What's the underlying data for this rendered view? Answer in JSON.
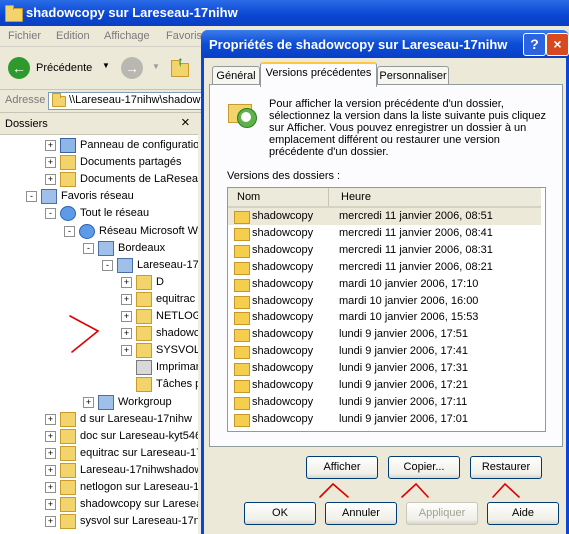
{
  "explorer": {
    "title": "shadowcopy sur Lareseau-17nihw",
    "menu": [
      "Fichier",
      "Edition",
      "Affichage",
      "Favoris"
    ],
    "back_label": "Précédente",
    "address_label": "Adresse",
    "address_value": "\\\\Lareseau-17nihw\\shadow",
    "folders_title": "Dossiers",
    "close_glyph": "×",
    "tree": [
      {
        "label": "Panneau de configuration",
        "indent": 1,
        "pm": "+",
        "icon": "control-panel-icon"
      },
      {
        "label": "Documents partagés",
        "indent": 1,
        "pm": "+",
        "icon": "folder-icon"
      },
      {
        "label": "Documents de LaReseau",
        "indent": 1,
        "pm": "+",
        "icon": "folder-icon"
      },
      {
        "label": "Favoris réseau",
        "indent": 0,
        "pm": "-",
        "icon": "network-places-icon"
      },
      {
        "label": "Tout le réseau",
        "indent": 1,
        "pm": "-",
        "icon": "globe-icon"
      },
      {
        "label": "Réseau Microsoft Win",
        "indent": 2,
        "pm": "-",
        "icon": "network-icon"
      },
      {
        "label": "Bordeaux",
        "indent": 3,
        "pm": "-",
        "icon": "workgroup-icon"
      },
      {
        "label": "Lareseau-17n",
        "indent": 4,
        "pm": "-",
        "icon": "computer-icon"
      },
      {
        "label": "D",
        "indent": 5,
        "pm": "+",
        "icon": "share-icon"
      },
      {
        "label": "equitrac",
        "indent": 5,
        "pm": "+",
        "icon": "share-icon"
      },
      {
        "label": "NETLOGC",
        "indent": 5,
        "pm": "+",
        "icon": "share-icon"
      },
      {
        "label": "shadowco",
        "indent": 5,
        "pm": "+",
        "icon": "share-icon"
      },
      {
        "label": "SYSVOL",
        "indent": 5,
        "pm": "+",
        "icon": "share-icon"
      },
      {
        "label": "Imprimant",
        "indent": 5,
        "pm": "",
        "icon": "printer-icon"
      },
      {
        "label": "Tâches pl",
        "indent": 5,
        "pm": "",
        "icon": "scheduled-tasks-icon"
      },
      {
        "label": "Workgroup",
        "indent": 3,
        "pm": "+",
        "icon": "workgroup-icon"
      },
      {
        "label": "d sur Lareseau-17nihw",
        "indent": 1,
        "pm": "+",
        "icon": "share-icon"
      },
      {
        "label": "doc sur Lareseau-kyt546",
        "indent": 1,
        "pm": "+",
        "icon": "share-icon"
      },
      {
        "label": "equitrac sur Lareseau-17n",
        "indent": 1,
        "pm": "+",
        "icon": "share-icon"
      },
      {
        "label": "Lareseau-17nihwshadow",
        "indent": 1,
        "pm": "+",
        "icon": "share-icon"
      },
      {
        "label": "netlogon sur Lareseau-17",
        "indent": 1,
        "pm": "+",
        "icon": "share-icon"
      },
      {
        "label": "shadowcopy sur Lareseau",
        "indent": 1,
        "pm": "+",
        "icon": "share-icon"
      },
      {
        "label": "sysvol sur Lareseau-17nil",
        "indent": 1,
        "pm": "+",
        "icon": "share-icon"
      }
    ]
  },
  "dialog": {
    "title": "Propriétés de shadowcopy sur Lareseau-17nihw",
    "help_glyph": "?",
    "close_glyph": "×",
    "tabs": [
      "Général",
      "Versions précédentes",
      "Personnaliser"
    ],
    "info_text": "Pour afficher la version précédente d'un dossier, sélectionnez la version dans la liste suivante puis cliquez sur Afficher. Vous pouvez enregistrer un dossier à un emplacement différent ou restaurer une version précédente d'un dossier.",
    "list_label": "Versions des dossiers :",
    "columns": [
      "Nom",
      "Heure"
    ],
    "rows": [
      {
        "name": "shadowcopy",
        "time": "mercredi 11 janvier 2006, 08:51"
      },
      {
        "name": "shadowcopy",
        "time": "mercredi 11 janvier 2006, 08:41"
      },
      {
        "name": "shadowcopy",
        "time": "mercredi 11 janvier 2006, 08:31"
      },
      {
        "name": "shadowcopy",
        "time": "mercredi 11 janvier 2006, 08:21"
      },
      {
        "name": "shadowcopy",
        "time": "mardi 10 janvier 2006, 17:10"
      },
      {
        "name": "shadowcopy",
        "time": "mardi 10 janvier 2006, 16:00"
      },
      {
        "name": "shadowcopy",
        "time": "mardi 10 janvier 2006, 15:53"
      },
      {
        "name": "shadowcopy",
        "time": "lundi 9 janvier 2006, 17:51"
      },
      {
        "name": "shadowcopy",
        "time": "lundi 9 janvier 2006, 17:41"
      },
      {
        "name": "shadowcopy",
        "time": "lundi 9 janvier 2006, 17:31"
      },
      {
        "name": "shadowcopy",
        "time": "lundi 9 janvier 2006, 17:21"
      },
      {
        "name": "shadowcopy",
        "time": "lundi 9 janvier 2006, 17:11"
      },
      {
        "name": "shadowcopy",
        "time": "lundi 9 janvier 2006, 17:01"
      }
    ],
    "action_buttons": {
      "view": "Afficher",
      "copy": "Copier...",
      "restore": "Restaurer"
    },
    "footer_buttons": {
      "ok": "OK",
      "cancel": "Annuler",
      "apply": "Appliquer",
      "help": "Aide"
    }
  },
  "colors": {
    "annotation": "#E00000",
    "title_bar": "#0A46D4",
    "selected_row": "#ECE9D8"
  }
}
